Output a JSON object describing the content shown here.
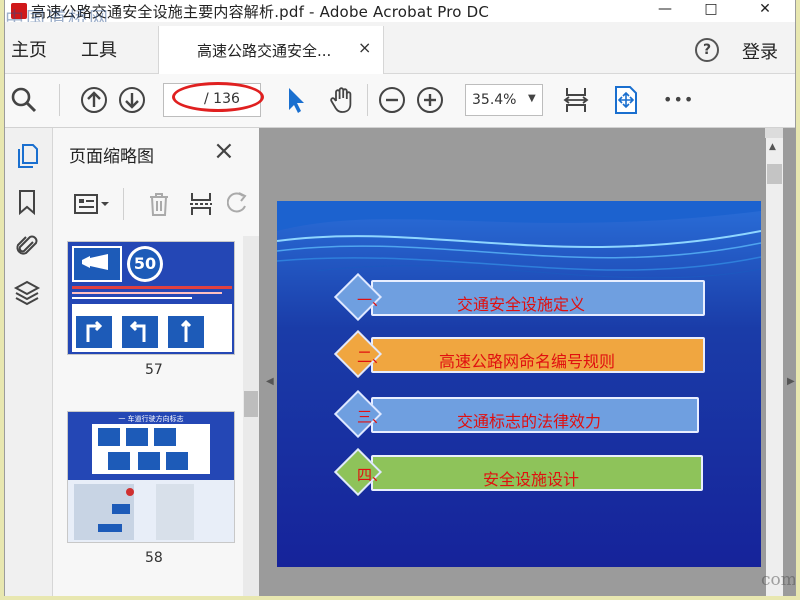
{
  "window": {
    "title": "高速公路交通安全设施主要内容解析.pdf - Adobe Acrobat Pro DC",
    "minimize": "—",
    "maximize": "□",
    "close": "✕",
    "watermark": "中国道桥网"
  },
  "menu": {
    "home": "主页",
    "tools": "工具",
    "doc_tab_label": "高速公路交通安全...",
    "doc_tab_close": "×",
    "help": "?",
    "login": "登录"
  },
  "toolbar": {
    "page_current": "",
    "page_total": "/ 136",
    "zoom": "35.4%",
    "more": "•••",
    "icons": [
      "search-icon",
      "prev-page-icon",
      "next-page-icon",
      "select-arrow-icon",
      "hand-icon",
      "zoom-out-icon",
      "zoom-in-icon",
      "fit-page-icon",
      "full-screen-icon",
      "more-icon"
    ]
  },
  "colors": {
    "accent": "#1a6fcf",
    "annotation_ellipse": "#e02020",
    "slide_text": "#e01010"
  },
  "sidebar": {
    "panel_title": "页面缩略图",
    "panel_close": "×",
    "thumbnails": [
      {
        "page": "57",
        "sign_speed": "50"
      },
      {
        "page": "58",
        "header": "一 车道行驶方向标志"
      }
    ]
  },
  "slide": {
    "items": [
      {
        "num": "一、",
        "label": "交通安全设施定义",
        "color": "#6f9fe0"
      },
      {
        "num": "二、",
        "label": "高速公路网命名编号规则",
        "color": "#f0a640"
      },
      {
        "num": "三、",
        "label": "交通标志的法律效力",
        "color": "#6f9fe0"
      },
      {
        "num": "四、",
        "label": "安全设施设计",
        "color": "#8ec35a"
      }
    ]
  },
  "corner_watermark": "com"
}
